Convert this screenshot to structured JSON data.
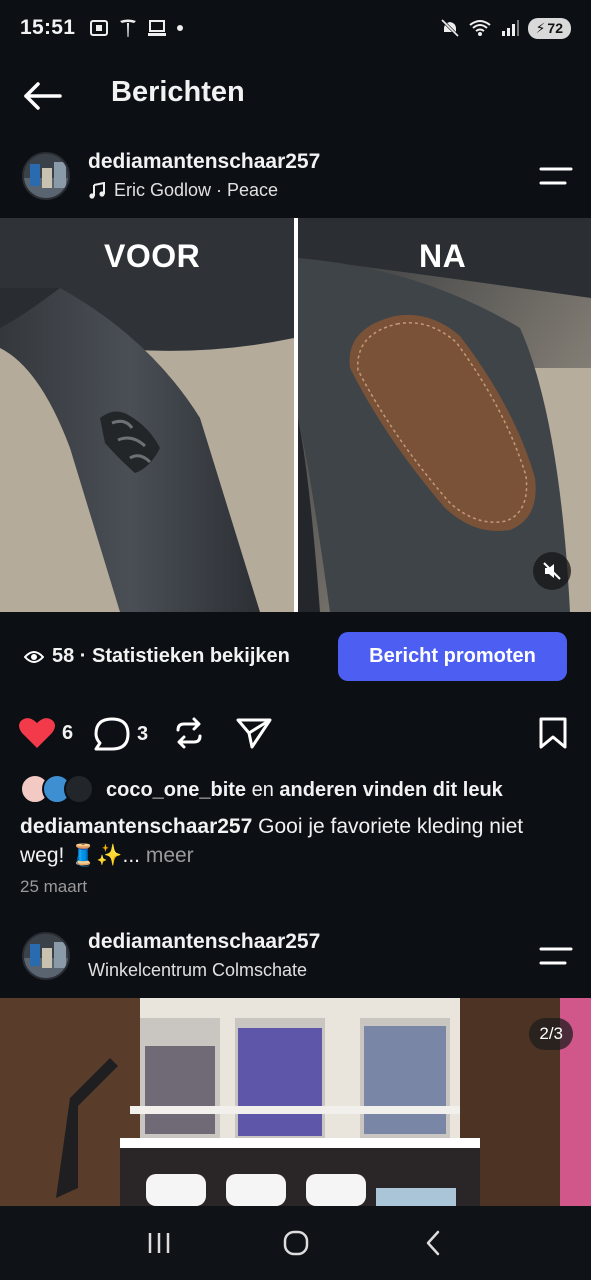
{
  "status": {
    "time": "15:51",
    "battery": "72"
  },
  "header": {
    "title": "Berichten"
  },
  "post1": {
    "username": "dediamantenschaar257",
    "music": "Eric Godlow · Peace",
    "label_before": "VOOR",
    "label_after": "NA",
    "views": "58 · Statistieken bekijken",
    "promote": "Bericht promoten",
    "likes_count": "6",
    "comments_count": "3",
    "liked_by_user": "coco_one_bite",
    "liked_by_rest": " en ",
    "liked_by_others": "anderen vinden dit leuk",
    "caption_user": "dediamantenschaar257",
    "caption_text": " Gooi je favoriete kleding niet weg! 🧵✨...",
    "caption_more": " meer",
    "date": "25 maart"
  },
  "post2": {
    "username": "dediamantenschaar257",
    "location": "Winkelcentrum Colmschate",
    "page_indicator": "2/3"
  },
  "colors": {
    "accent": "#4d5ff2",
    "like": "#f23a4a",
    "background": "#0c0f14"
  }
}
